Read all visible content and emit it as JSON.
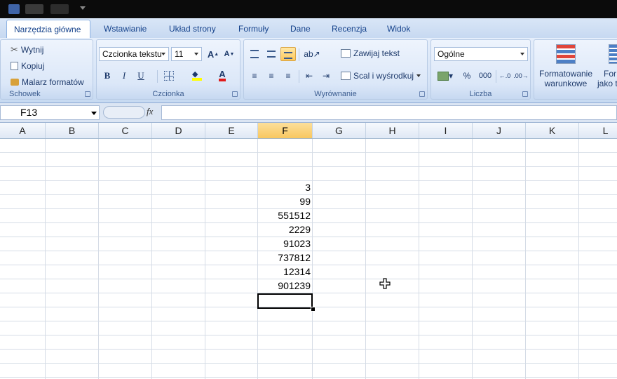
{
  "tabs": [
    {
      "label": "Narzędzia główne",
      "active": true
    },
    {
      "label": "Wstawianie"
    },
    {
      "label": "Układ strony"
    },
    {
      "label": "Formuły"
    },
    {
      "label": "Dane"
    },
    {
      "label": "Recenzja"
    },
    {
      "label": "Widok"
    }
  ],
  "ribbon": {
    "clipboard": {
      "label": "Schowek",
      "cut": "Wytnij",
      "copy": "Kopiuj",
      "format_painter": "Malarz formatów"
    },
    "font": {
      "label": "Czcionka",
      "font_name": "Czcionka tekstu",
      "font_size": "11"
    },
    "alignment": {
      "label": "Wyrównanie",
      "wrap_text": "Zawijaj tekst",
      "merge_center": "Scal i wyśrodkuj"
    },
    "number": {
      "label": "Liczba",
      "format": "Ogólne",
      "percent": "%",
      "thousands": "000"
    },
    "styles": {
      "conditional_formatting_line1": "Formatowanie",
      "conditional_formatting_line2": "warunkowe",
      "format_as_table_line1": "For",
      "format_as_table_line2": "jako t"
    }
  },
  "formula_bar": {
    "name_box": "F13",
    "fx": "fx",
    "formula": ""
  },
  "columns": [
    "A",
    "B",
    "C",
    "D",
    "E",
    "F",
    "G",
    "H",
    "I",
    "J",
    "K",
    "L"
  ],
  "selected_column": "F",
  "cells": [
    {
      "ref": "F5",
      "value": "3"
    },
    {
      "ref": "F6",
      "value": "99"
    },
    {
      "ref": "F7",
      "value": "551512"
    },
    {
      "ref": "F8",
      "value": "2229"
    },
    {
      "ref": "F9",
      "value": "91023"
    },
    {
      "ref": "F10",
      "value": "737812"
    },
    {
      "ref": "F11",
      "value": "12314"
    },
    {
      "ref": "F12",
      "value": "901239"
    }
  ],
  "active_cell": "F13",
  "colors": {
    "ribbon_text": "#15428b",
    "selected_header": "#f8c75f",
    "gridline": "#d5dce6"
  }
}
